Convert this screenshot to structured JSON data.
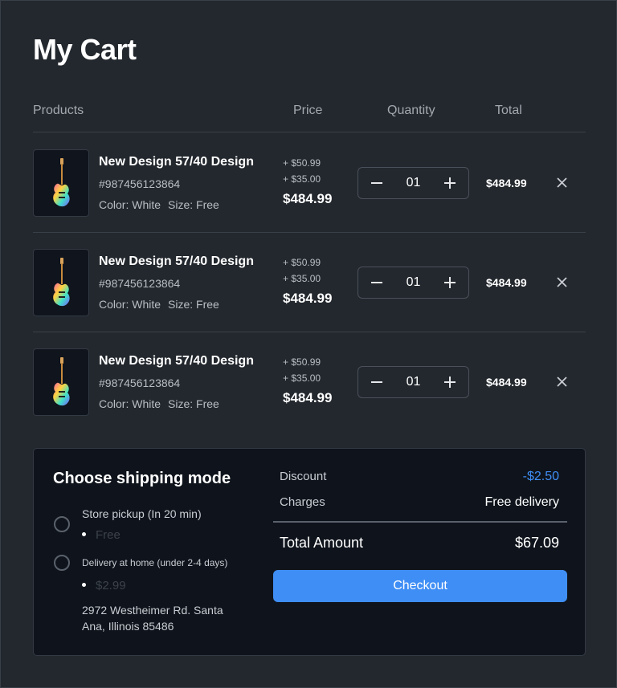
{
  "page": {
    "title": "My Cart"
  },
  "table": {
    "headers": {
      "products": "Products",
      "price": "Price",
      "quantity": "Quantity",
      "total": "Total"
    }
  },
  "items": [
    {
      "name": "New Design 57/40 Design",
      "sku": "#987456123864",
      "color": "Color: White",
      "size": "Size: Free",
      "addon1": "+ $50.99",
      "addon2": "+ $35.00",
      "price": "$484.99",
      "quantity": "01",
      "total": "$484.99",
      "image_icon": "electric-guitar-icon"
    },
    {
      "name": "New Design 57/40 Design",
      "sku": "#987456123864",
      "color": "Color: White",
      "size": "Size: Free",
      "addon1": "+ $50.99",
      "addon2": "+ $35.00",
      "price": "$484.99",
      "quantity": "01",
      "total": "$484.99",
      "image_icon": "electric-guitar-icon"
    },
    {
      "name": "New Design 57/40 Design",
      "sku": "#987456123864",
      "color": "Color: White",
      "size": "Size: Free",
      "addon1": "+ $50.99",
      "addon2": "+ $35.00",
      "price": "$484.99",
      "quantity": "01",
      "total": "$484.99",
      "image_icon": "electric-guitar-icon"
    }
  ],
  "shipping": {
    "title": "Choose shipping mode",
    "options": [
      {
        "label": "Store pickup (In 20 min)",
        "price": "Free",
        "selected": false
      },
      {
        "label": "Delivery at home (under 2-4 days)",
        "price": "$2.99",
        "selected": false,
        "address": "2972 Westheimer Rd. Santa Ana, Illinois 85486"
      }
    ]
  },
  "summary": {
    "discount_label": "Discount",
    "discount_value": "-$2.50",
    "charges_label": "Charges",
    "charges_value": "Free delivery",
    "total_label": "Total Amount",
    "total_value": "$67.09",
    "checkout_label": "Checkout"
  },
  "colors": {
    "background": "#23282e",
    "panel": "#0f141c",
    "accent": "#3f8ef5",
    "muted_text": "#a3a8b0"
  },
  "icons": {
    "decrement": "minus-icon",
    "increment": "plus-icon",
    "remove": "close-icon",
    "radio": "radio-unchecked-icon"
  }
}
